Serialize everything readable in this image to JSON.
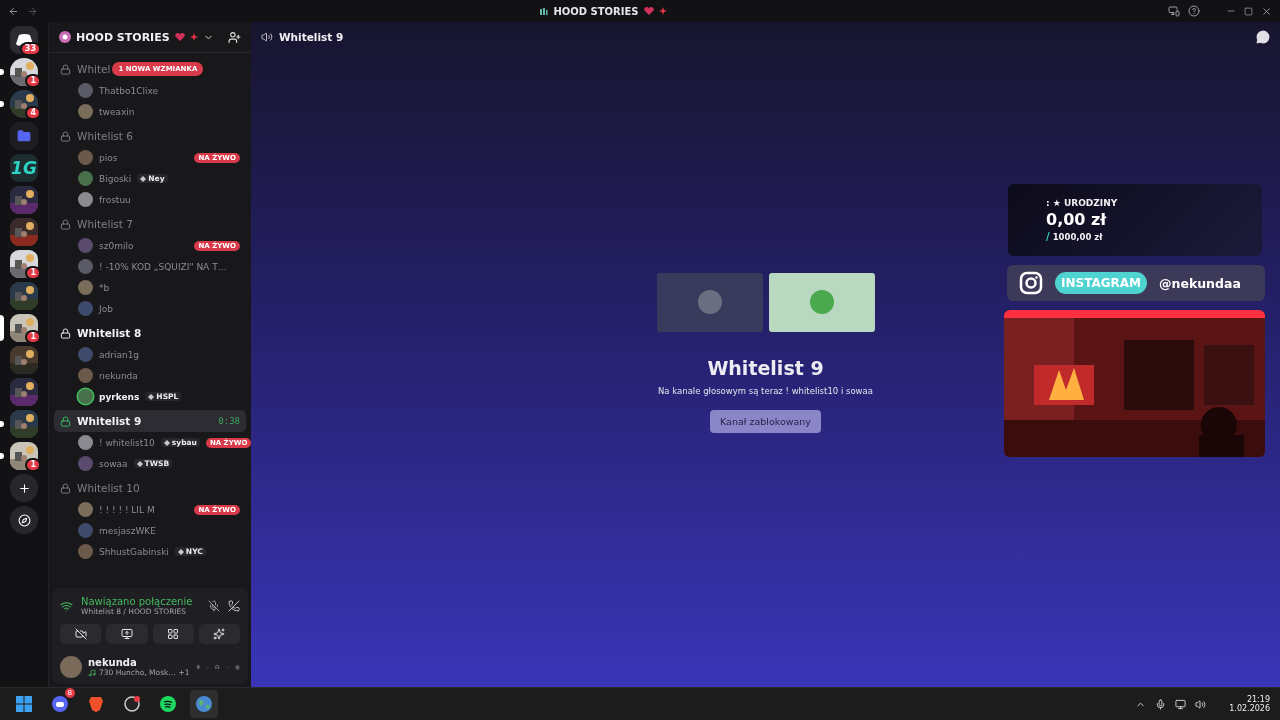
{
  "titlebar": {
    "title": "HOOD STORIES"
  },
  "servers": [
    {
      "kind": "home",
      "badge": "33",
      "unread": false,
      "selected": false
    },
    {
      "kind": "avatar",
      "badge": "1",
      "unread": true,
      "selected": false
    },
    {
      "kind": "avatar",
      "badge": "4",
      "unread": true,
      "selected": false
    },
    {
      "kind": "folder",
      "unread": false,
      "selected": false
    },
    {
      "kind": "logo",
      "label": "1G",
      "unread": false,
      "selected": false
    },
    {
      "kind": "server",
      "unread": false,
      "selected": false
    },
    {
      "kind": "server",
      "unread": false,
      "selected": false
    },
    {
      "kind": "server",
      "badge": "1",
      "unread": false,
      "selected": false
    },
    {
      "kind": "server",
      "unread": false,
      "selected": false
    },
    {
      "kind": "server",
      "badge": "1",
      "unread": false,
      "selected": true
    },
    {
      "kind": "server",
      "unread": false,
      "selected": false
    },
    {
      "kind": "server",
      "unread": false,
      "selected": false
    },
    {
      "kind": "group",
      "unread": true,
      "selected": false
    },
    {
      "kind": "group",
      "badge": "1",
      "unread": true,
      "selected": false
    },
    {
      "kind": "add",
      "unread": false,
      "selected": false
    },
    {
      "kind": "discover",
      "unread": false,
      "selected": false
    }
  ],
  "server": {
    "name": "HOOD STORIES"
  },
  "mention_pill": "1 NOWA WZMIANKA",
  "channels": [
    {
      "name": "Whitel",
      "selected": false,
      "unread": false,
      "users": [
        {
          "name": "Thatbo1Clixe",
          "speaking": false
        },
        {
          "name": "tweaxin",
          "speaking": false
        }
      ]
    },
    {
      "name": "Whitelist 6",
      "selected": false,
      "unread": false,
      "users": [
        {
          "name": "pios",
          "speaking": false,
          "live": "NA ŻYWO"
        },
        {
          "name": "Bigoski",
          "speaking": false,
          "tag": "Ney"
        },
        {
          "name": "frostuu",
          "speaking": false
        }
      ]
    },
    {
      "name": "Whitelist 7",
      "selected": false,
      "unread": false,
      "users": [
        {
          "name": "sz0milo",
          "speaking": false,
          "live": "NA ŻYWO"
        },
        {
          "name": "! -10% KOD „SQUIZI\" NA T…",
          "speaking": false
        },
        {
          "name": "*b",
          "speaking": false
        },
        {
          "name": "Job",
          "speaking": false
        }
      ]
    },
    {
      "name": "Whitelist 8",
      "selected": false,
      "unread": true,
      "users": [
        {
          "name": "adrian1g",
          "speaking": false
        },
        {
          "name": "nekunda",
          "speaking": false
        },
        {
          "name": "pyrkens",
          "speaking": true,
          "tag": "HSPL"
        }
      ]
    },
    {
      "name": "Whitelist 9",
      "selected": true,
      "unread": true,
      "timer": "0:38",
      "users": [
        {
          "name": "! whitelist10",
          "speaking": false,
          "tag": "sybau",
          "live": "NA ŻYWO"
        },
        {
          "name": "sowaa",
          "speaking": false,
          "tag": "TWSB"
        }
      ]
    },
    {
      "name": "Whitelist 10",
      "selected": false,
      "unread": false,
      "users": [
        {
          "name": "! ! ! ! ! LIL M",
          "speaking": false,
          "live": "NA ŻYWO"
        },
        {
          "name": "mesjaszWKE",
          "speaking": false
        },
        {
          "name": "ShhustGabinski",
          "speaking": false,
          "tag": "NYC"
        }
      ]
    }
  ],
  "voice": {
    "status": "Nawiązano połączenie",
    "location": "Whitelist 8 / HOOD STORIES"
  },
  "user": {
    "name": "nekunda",
    "activity": "730 Huncho, Mosk...",
    "extra": "+1"
  },
  "main": {
    "channel": "Whitelist 9",
    "tiles": [
      {
        "kind": "dark"
      },
      {
        "kind": "light"
      }
    ],
    "title": "Whitelist 9",
    "description": "Na kanale głosowym są teraz ! whitelist10 i sowaa",
    "button": "Kanał zablokowany"
  },
  "overlay": {
    "goal_label": ": ★ URODZINY",
    "goal_amount": "0,00 zł",
    "goal_slash": "/",
    "goal_target": "1000,00 zł",
    "instagram_label": "INSTAGRAM",
    "instagram_handle": "@nekundaa"
  },
  "taskbar": {
    "apps": [
      {
        "kind": "start",
        "selected": false
      },
      {
        "kind": "discord",
        "badge": "8",
        "selected": false
      },
      {
        "kind": "brave",
        "selected": false
      },
      {
        "kind": "obs",
        "selected": false
      },
      {
        "kind": "spotify",
        "selected": false
      },
      {
        "kind": "globe",
        "selected": true
      }
    ],
    "time": "21:19",
    "date": "1.02.2026"
  }
}
